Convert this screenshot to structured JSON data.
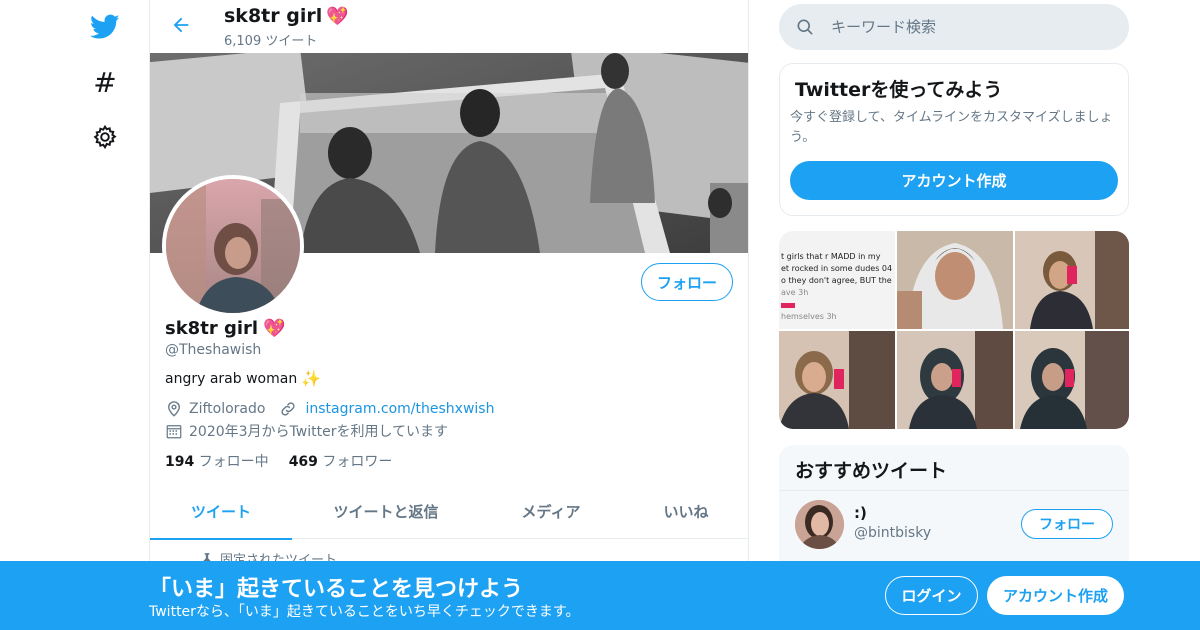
{
  "colors": {
    "accent": "#1da1f2",
    "link": "#1b95e0",
    "muted": "#657786",
    "heart": "#e0245e",
    "border": "#e6ecf0"
  },
  "nav": {
    "icons": [
      "twitter-logo-icon",
      "hashtag-icon",
      "gear-icon"
    ],
    "hash_glyph": "#"
  },
  "header": {
    "name": "sk8tr girl",
    "name_emoji": "💖",
    "tweet_count": "6,109 ツイート"
  },
  "profile": {
    "name": "sk8tr girl",
    "name_emoji": "💖",
    "handle": "@Theshawish",
    "bio": "angry arab woman",
    "bio_emoji": "✨",
    "location": "Ziftolorado",
    "website": "instagram.com/theshxwish",
    "joined": "2020年3月からTwitterを利用しています",
    "following_count": "194",
    "following_label": "フォロー中",
    "followers_count": "469",
    "followers_label": "フォロワー",
    "follow_button": "フォロー"
  },
  "tabs": [
    {
      "label": "ツイート",
      "active": true
    },
    {
      "label": "ツイートと返信",
      "active": false
    },
    {
      "label": "メディア",
      "active": false
    },
    {
      "label": "いいね",
      "active": false
    }
  ],
  "pinned_label": "固定されたツイート",
  "search": {
    "placeholder": "キーワード検索"
  },
  "signup_card": {
    "title": "Twitterを使ってみよう",
    "description": "今すぐ登録して、タイムラインをカスタマイズしましょう。",
    "button": "アカウント作成"
  },
  "media_grid": {
    "tweet_screenshot_lines": [
      "t girls that r MADD in my",
      "et rocked in some dudes 04",
      "o they don't agree, BUT the",
      "ave 3h",
      "hemselves 3h"
    ]
  },
  "recommended": {
    "title": "おすすめツイート",
    "user_name": ":)",
    "user_handle": "@bintbisky",
    "follow_button": "フォロー"
  },
  "bottom_bar": {
    "title": "「いま」起きていることを見つけよう",
    "subtitle": "Twitterなら、「いま」起きていることをいち早くチェックできます。",
    "login": "ログイン",
    "signup": "アカウント作成"
  }
}
